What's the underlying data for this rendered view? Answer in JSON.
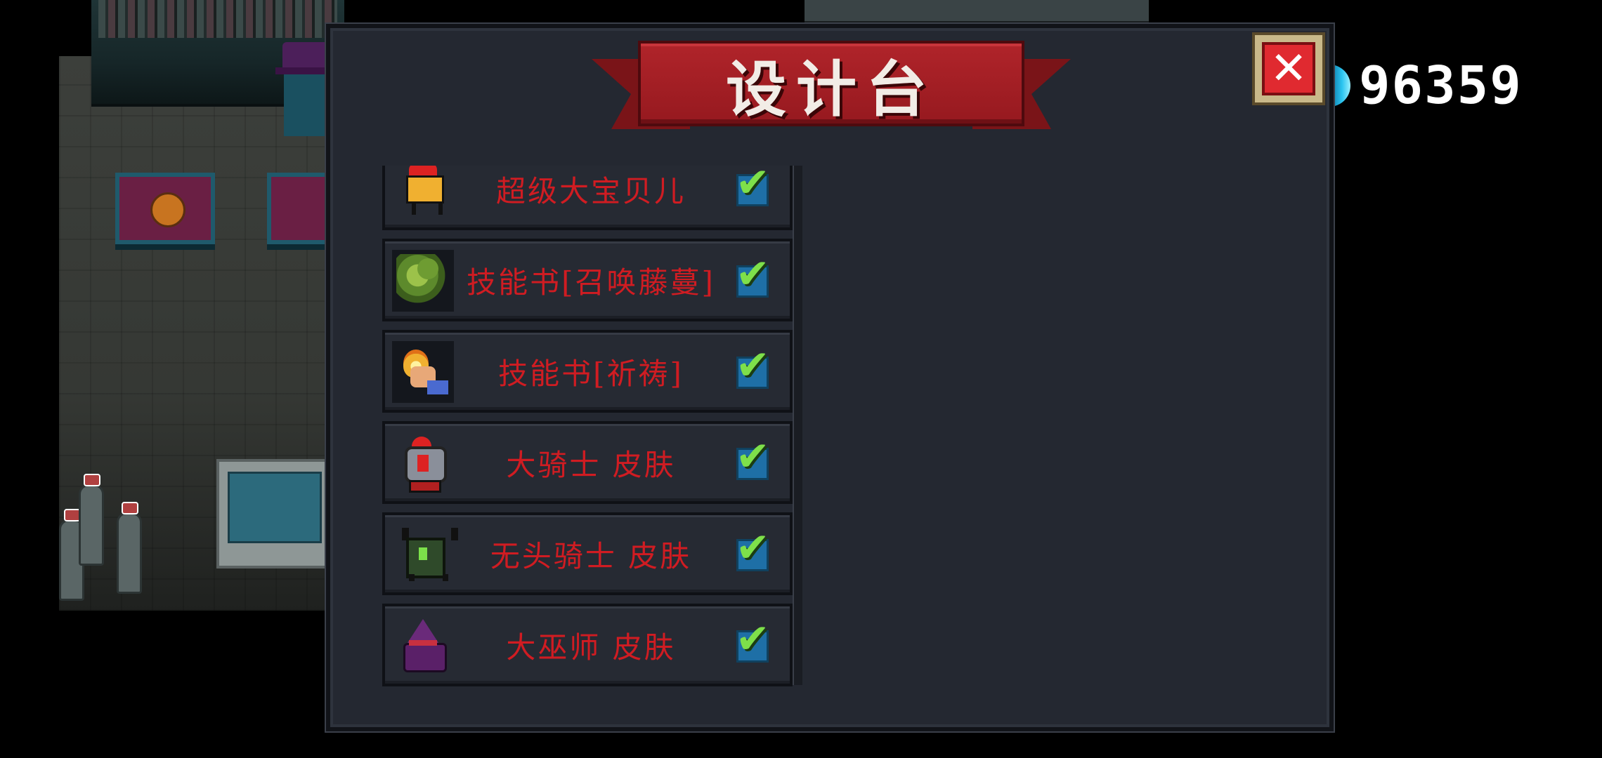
{
  "panel": {
    "title": "设计台",
    "close": {
      "glyph": "✕",
      "icon": "close-icon"
    }
  },
  "currency": {
    "icon": "gem-icon",
    "value": "96359",
    "color": "#2ac4f0"
  },
  "colors": {
    "label": "#d01c22",
    "checkbox": "#1e6fa6",
    "check": "#7ee04a",
    "banner": "#b0242a"
  },
  "items": [
    {
      "label": "超级大宝贝儿",
      "icon": "super-baby-icon",
      "checked": true
    },
    {
      "label": "技能书[召唤藤蔓]",
      "icon": "vine-skill-book-icon",
      "checked": true
    },
    {
      "label": "技能书[祈祷]",
      "icon": "prayer-skill-book-icon",
      "checked": true
    },
    {
      "label": "大骑士 皮肤",
      "icon": "grand-knight-skin-icon",
      "checked": true
    },
    {
      "label": "无头骑士 皮肤",
      "icon": "headless-knight-skin-icon",
      "checked": true
    },
    {
      "label": "大巫师 皮肤",
      "icon": "grand-wizard-skin-icon",
      "checked": true
    }
  ],
  "check_glyph": "✔"
}
